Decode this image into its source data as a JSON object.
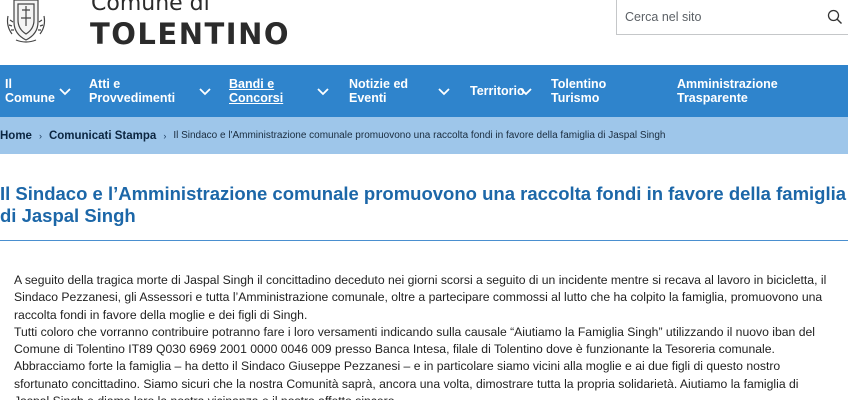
{
  "header": {
    "brand_small": "Comune di",
    "brand_big": "TOLENTINO",
    "search_placeholder": "Cerca nel sito"
  },
  "nav": {
    "items": [
      {
        "label": "Il\nComune"
      },
      {
        "label": "Atti e\nProvvedimenti"
      },
      {
        "label": "Bandi e\nConcorsi"
      },
      {
        "label": "Notizie ed\nEventi"
      },
      {
        "label": "Territorio"
      },
      {
        "label": "Tolentino\nTurismo"
      },
      {
        "label": "Amministrazione\nTrasparente"
      }
    ]
  },
  "breadcrumb": {
    "home": "Home",
    "section": "Comunicati Stampa",
    "current": "Il Sindaco e l'Amministrazione comunale promuovono una raccolta fondi in favore della famiglia di Jaspal Singh",
    "separator": "›"
  },
  "article": {
    "title": "Il Sindaco e l’Amministrazione comunale promuovono una raccolta fondi in favore della famiglia di Jaspal Singh",
    "paragraphs": [
      "A seguito della tragica morte di Jaspal Singh il concittadino deceduto nei giorni scorsi a seguito di un incidente mentre si recava al lavoro in bicicletta, il Sindaco Pezzanesi, gli Assessori e tutta l’Amministrazione comunale, oltre a partecipare commossi al lutto che ha colpito la famiglia, promuovono una raccolta fondi in favore della moglie e dei figli di Singh.",
      "Tutti coloro che vorranno contribuire potranno fare i loro versamenti indicando sulla causale “Aiutiamo la Famiglia Singh” utilizzando il nuovo iban del Comune di Tolentino IT89 Q030 6969 2001 0000 0046 009 presso Banca Intesa, filale di Tolentino dove è funzionante la Tesoreria comunale.",
      "Abbracciamo forte la famiglia – ha detto il Sindaco Giuseppe Pezzanesi – e in particolare siamo vicini alla moglie e ai due figli di questo nostro sfortunato concittadino. Siamo sicuri che la nostra Comunità saprà, ancora una volta, dimostrare tutta la propria solidarietà. Aiutiamo la famiglia di Jaspal Singh e diamo loro la nostra vicinanza e il nostro affetto sincero."
    ]
  }
}
